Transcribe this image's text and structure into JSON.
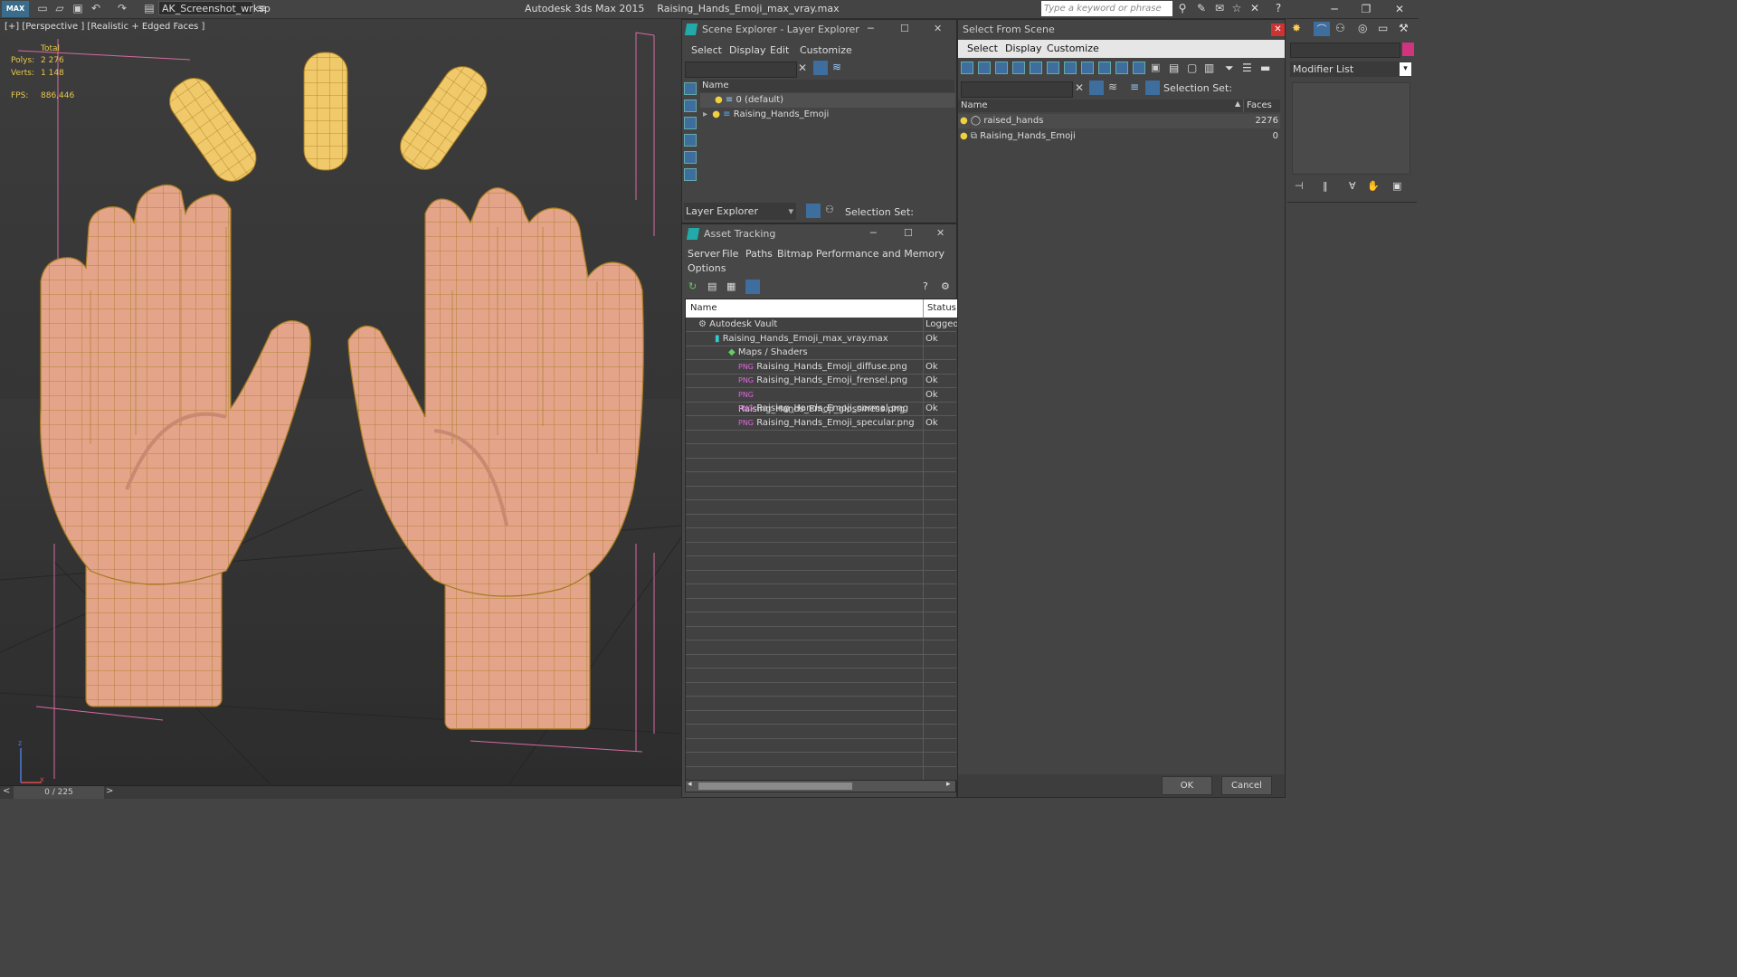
{
  "titlebar": {
    "logo_text": "MAX",
    "workspace": "AK_Screenshot_wrksp",
    "app_name": "Autodesk 3ds Max  2015",
    "file_name": "Raising_Hands_Emoji_max_vray.max",
    "search_placeholder": "Type a keyword or phrase"
  },
  "viewport": {
    "label": "[+] [Perspective ] [Realistic + Edged Faces ]",
    "stats_total": "Total",
    "polys_label": "Polys:",
    "polys_value": "2 276",
    "verts_label": "Verts:",
    "verts_value": "1 148",
    "fps_label": "FPS:",
    "fps_value": "886,446",
    "axis_z": "z",
    "axis_x": "x"
  },
  "timeline": {
    "counter": "0 / 225",
    "prev": "<",
    "next": ">"
  },
  "scene_explorer": {
    "title": "Scene Explorer - Layer Explorer",
    "menu": [
      "Select",
      "Display",
      "Edit",
      "Customize"
    ],
    "col_name": "Name",
    "layers": [
      "0 (default)",
      "Raising_Hands_Emoji"
    ],
    "footer_dropdown": "Layer Explorer",
    "selection_set": "Selection Set:"
  },
  "asset_tracking": {
    "title": "Asset Tracking",
    "menu": [
      "Server",
      "File",
      "Paths",
      "Bitmap Performance and Memory"
    ],
    "menu_row2": "Options",
    "col_name": "Name",
    "col_status": "Status",
    "rows": [
      {
        "name": "Autodesk Vault",
        "status": "Logged"
      },
      {
        "name": "Raising_Hands_Emoji_max_vray.max",
        "status": "Ok"
      },
      {
        "name": "Maps / Shaders",
        "status": ""
      },
      {
        "name": "Raising_Hands_Emoji_diffuse.png",
        "status": "Ok"
      },
      {
        "name": "Raising_Hands_Emoji_frensel.png",
        "status": "Ok"
      },
      {
        "name": "Raising_Hands_Emoji_glossiness.png",
        "status": "Ok"
      },
      {
        "name": "Raising_Hands_Emoji_normal.png",
        "status": "Ok"
      },
      {
        "name": "Raising_Hands_Emoji_specular.png",
        "status": "Ok"
      }
    ]
  },
  "select_from_scene": {
    "title": "Select From Scene",
    "menu": [
      "Select",
      "Display",
      "Customize"
    ],
    "selection_set": "Selection Set:",
    "col_name": "Name",
    "col_faces": "Faces",
    "rows": [
      {
        "name": "raised_hands",
        "faces": "2276"
      },
      {
        "name": "Raising_Hands_Emoji",
        "faces": "0"
      }
    ],
    "ok": "OK",
    "cancel": "Cancel"
  },
  "command_panel": {
    "modifier_list": "Modifier List"
  },
  "colors": {
    "accent": "#3d6e9e",
    "hand_skin": "#e3a48a",
    "wire": "#a67a1c",
    "stats": "#e8c84a"
  }
}
